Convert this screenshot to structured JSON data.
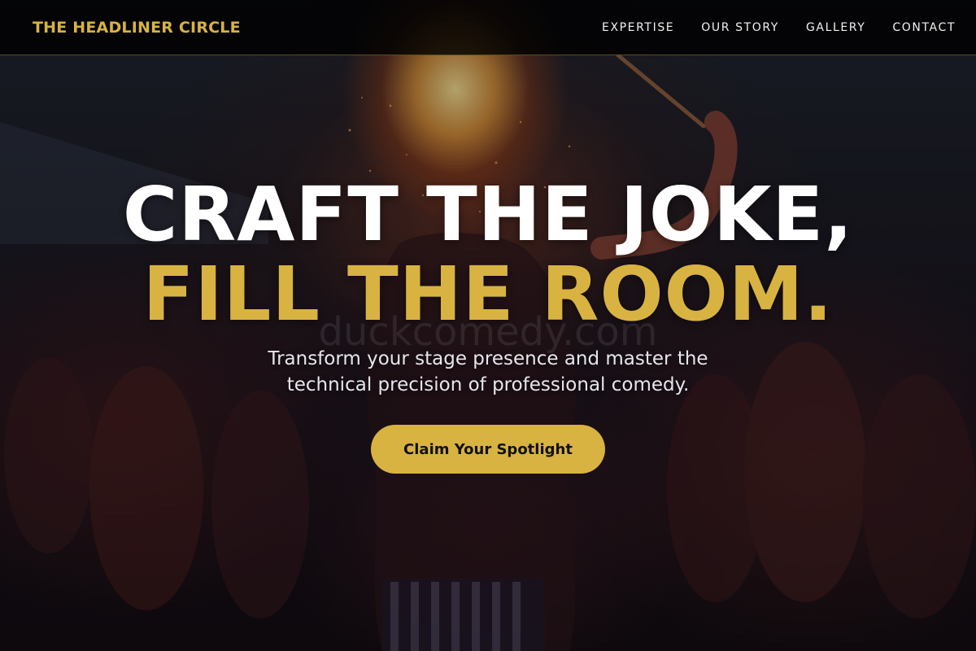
{
  "nav": {
    "brand": "THE HEADLINER CIRCLE",
    "links": [
      {
        "label": "EXPERTISE"
      },
      {
        "label": "OUR STORY"
      },
      {
        "label": "GALLERY"
      },
      {
        "label": "CONTACT"
      }
    ]
  },
  "hero": {
    "headline_line1": "CRAFT THE JOKE,",
    "headline_line2": "FILL THE ROOM.",
    "watermark": "duckcomedy.com",
    "subtitle": "Transform your stage presence and master the technical precision of professional comedy.",
    "cta_label": "Claim Your Spotlight"
  },
  "colors": {
    "accent": "#d8b341",
    "nav_background": "#000000",
    "headline": "#ffffff",
    "cta_text": "#111111"
  }
}
